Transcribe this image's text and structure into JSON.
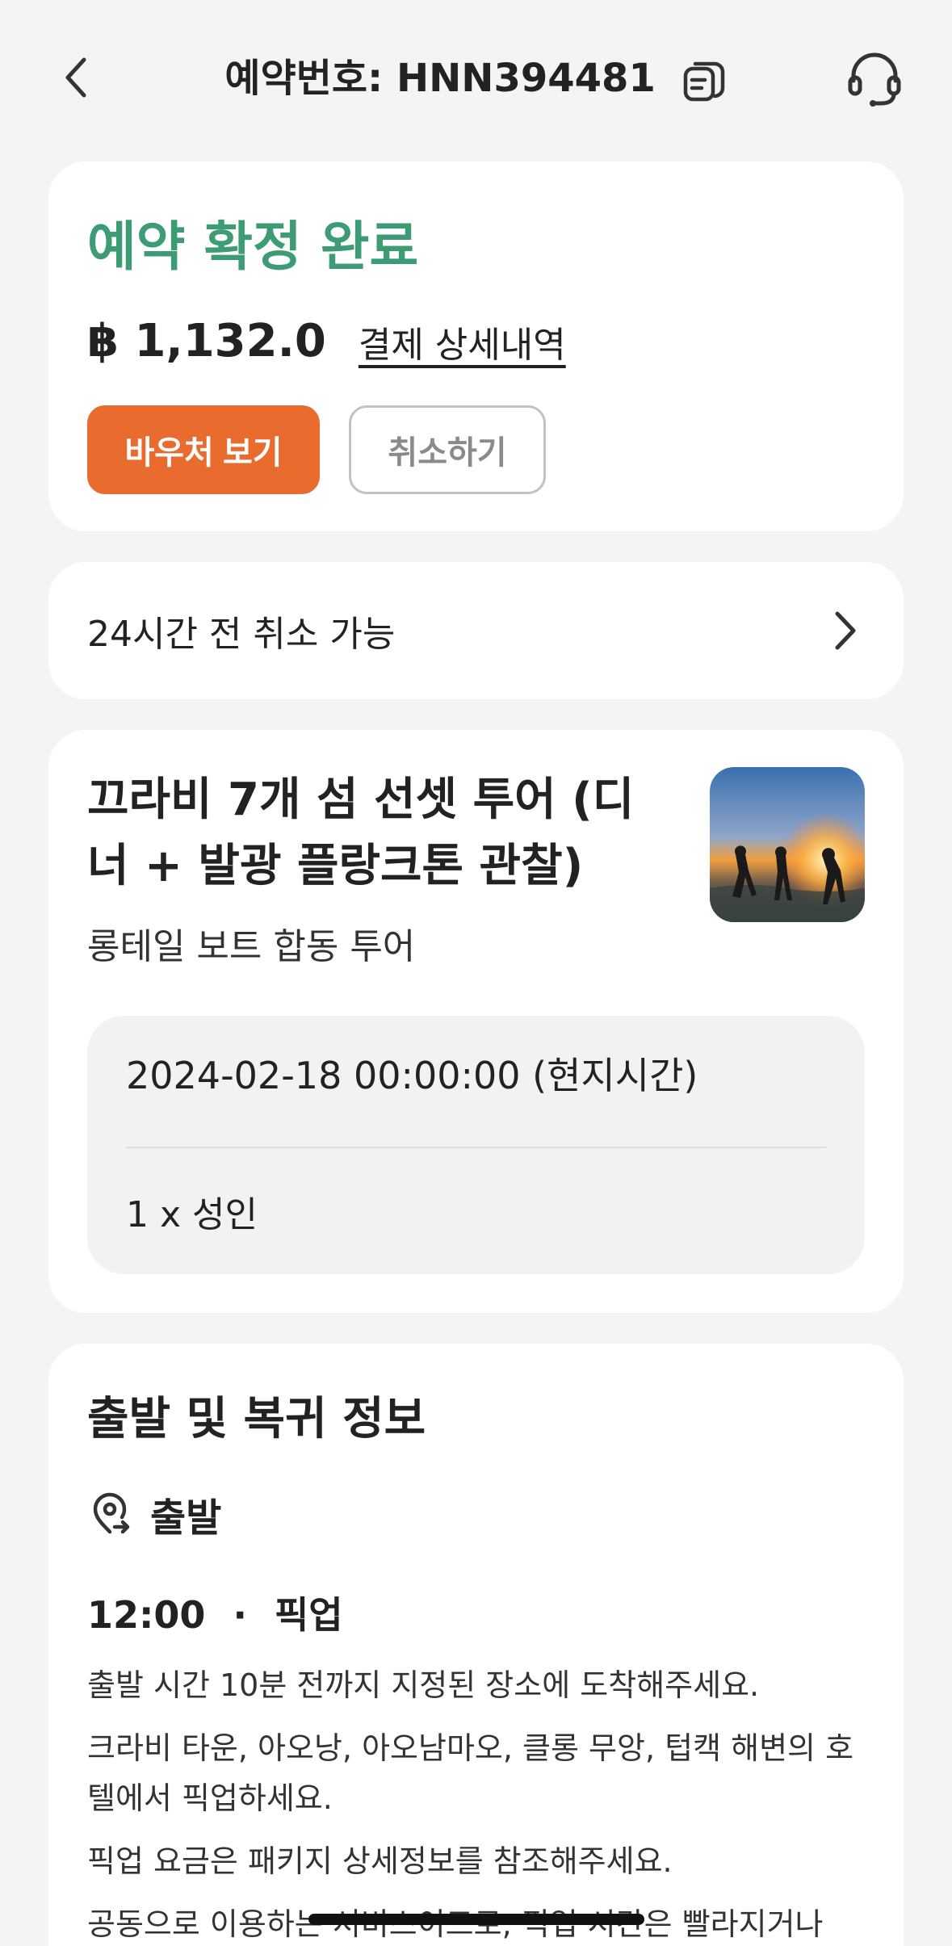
{
  "header": {
    "title": "예약번호: HNN394481",
    "back_icon": "chevron-left-icon",
    "copy_icon": "copy-icon",
    "support_icon": "headset-icon"
  },
  "booking": {
    "status": "예약 확정 완료",
    "status_color": "#3d9c75",
    "price": "฿ 1,132.0",
    "payment_detail_link": "결제 상세내역",
    "voucher_button": "바우처 보기",
    "cancel_button": "취소하기",
    "accent_color": "#ea6b2e"
  },
  "cancellation": {
    "label": "24시간 전 취소 가능"
  },
  "tour": {
    "title": "끄라비 7개 섬 선셋 투어 (디너 + 발광 플랑크톤 관찰)",
    "subtitle": "롱테일 보트 합동 투어",
    "datetime": "2024-02-18 00:00:00 (현지시간)",
    "pax": "1 x 성인"
  },
  "departure": {
    "section_title": "출발 및 복귀 정보",
    "depart_label": "출발",
    "time": "12:00",
    "separator": "·",
    "type": "픽업",
    "lines": [
      "출발 시간 10분 전까지 지정된 장소에 도착해주세요.",
      "크라비 타운, 아오낭, 아오남마오, 클롱 무앙, 텁캑 해변의 호텔에서 픽업하세요.",
      "픽업 요금은 패키지 상세정보를 참조해주세요.",
      "공동으로 이용하는 서비스이므로, 픽업 시간은 빨라지거나"
    ]
  }
}
